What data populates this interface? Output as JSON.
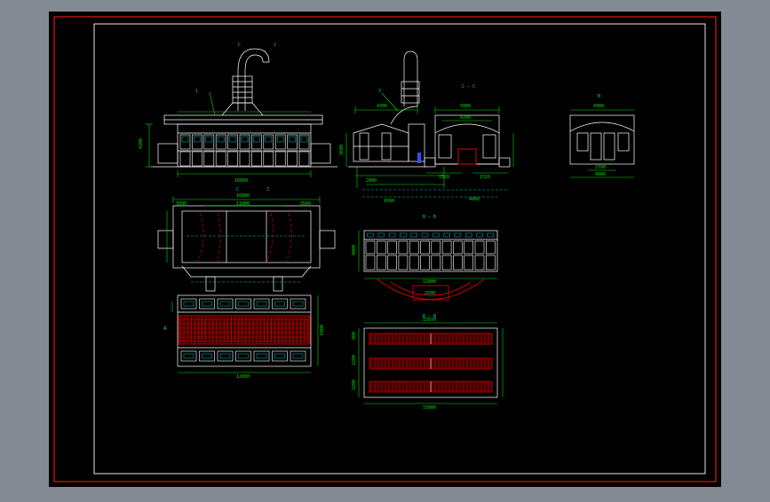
{
  "colors": {
    "desktop": "#848a94",
    "paper": "#000000",
    "border_red": "#e01818",
    "frame_white": "#ffffff",
    "geometry": "#ffffff",
    "dimension": "#00e000",
    "leader": "#00c0c0",
    "hatch_red": "#e00000",
    "hidden_magenta": "#c000c0",
    "door_blue": "#3050ff"
  },
  "labels": {
    "section_cc_top": "C",
    "note_top": "2",
    "section_cc_side": "C — C",
    "detail_b": "B",
    "section_bb_1": "B — B",
    "section_bb_2": "B — B",
    "detail_a": "A",
    "section_c_plan": "C",
    "section_z_plan": "Z",
    "leader_1": "1",
    "leader_3": "3"
  },
  "dimensions": {
    "front_total": "16800",
    "front_height": "4200",
    "side_width_top": "4300",
    "side_total": "9500",
    "side_height": "3600",
    "side_left_span": "2800",
    "side_right_span": "4800",
    "cc_width": "5000",
    "cc_span": "4200",
    "cc_left": "1520",
    "cc_right": "1520",
    "b_width": "4300",
    "b_inner": "2700",
    "b_total": "4900",
    "plan_span_left": "3500",
    "plan_mid": "11000",
    "plan_span_right": "3500",
    "plan_overall": "16800",
    "bb1_width": "12000",
    "bb1_height": "4000",
    "bb1_pit": "2500",
    "bb2_top": "15070",
    "bb2_bottom": "15000",
    "bb2_rows": [
      "800",
      "2200",
      "2200"
    ],
    "floor_width": "12000",
    "floor_height": "6000"
  }
}
